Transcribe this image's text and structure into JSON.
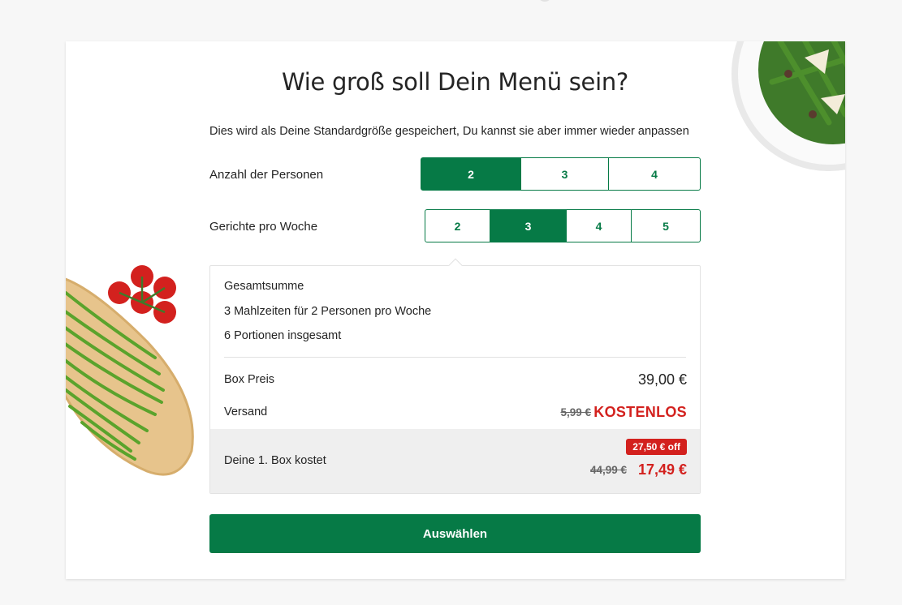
{
  "header": {
    "title": "Wie groß soll Dein Menü sein?",
    "subtitle": "Dies wird als Deine Standardgröße gespeichert, Du kannst sie aber immer wieder anpassen"
  },
  "persons": {
    "label": "Anzahl der Personen",
    "options": [
      "2",
      "3",
      "4"
    ],
    "selected": "2"
  },
  "meals": {
    "label": "Gerichte pro Woche",
    "options": [
      "2",
      "3",
      "4",
      "5"
    ],
    "selected": "3"
  },
  "summary": {
    "heading": "Gesamtsumme",
    "meals_text": "3 Mahlzeiten für 2 Personen pro Woche",
    "portions_text": "6 Portionen insgesamt",
    "box_price_label": "Box Preis",
    "box_price_value": "39,00 €",
    "shipping_label": "Versand",
    "shipping_old": "5,99 €",
    "shipping_new": "KOSTENLOS",
    "first_box_label": "Deine 1. Box kostet",
    "discount_badge": "27,50 € off",
    "first_box_old": "44,99 €",
    "first_box_new": "17,49 €"
  },
  "cta": {
    "label": "Auswählen"
  },
  "colors": {
    "brand_green": "#067a46",
    "sale_red": "#d3211e"
  },
  "decor": {
    "plate_image": "salad-plate-image",
    "board_image": "green-beans-board-image",
    "tomato_image": "tomatoes-image"
  }
}
